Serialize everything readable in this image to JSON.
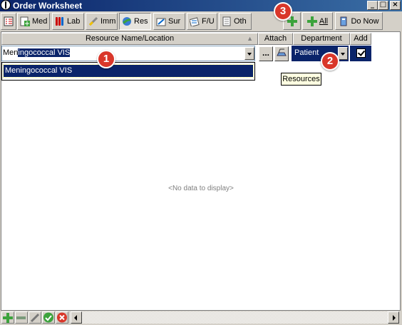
{
  "window": {
    "title": "Order Worksheet"
  },
  "tabs": [
    {
      "label": "",
      "icon": "checklist-icon"
    },
    {
      "label": "Med",
      "icon": "medication-icon"
    },
    {
      "label": "Lab",
      "icon": "test-tubes-icon"
    },
    {
      "label": "Imm",
      "icon": "syringe-icon"
    },
    {
      "label": "Res",
      "icon": "resources-icon",
      "active": true
    },
    {
      "label": "Sur",
      "icon": "surgery-icon"
    },
    {
      "label": "F/U",
      "icon": "follow-up-icon"
    },
    {
      "label": "Oth",
      "icon": "other-icon"
    }
  ],
  "toolbar": {
    "add_all_label": "All",
    "do_now_label": "Do Now"
  },
  "grid": {
    "headers": {
      "resource": "Resource Name/Location",
      "attach": "Attach",
      "department": "Department",
      "add": "Add"
    },
    "row": {
      "resource_typed": "Men",
      "resource_selected": "ingococcal VIS",
      "attach_button": "...",
      "department": "Patient",
      "add_checked": true
    },
    "dropdown_items": [
      "Meningococcal VIS"
    ],
    "empty_text": "<No data to display>"
  },
  "tooltip": "Resources",
  "badges": [
    "1",
    "2",
    "3"
  ],
  "colors": {
    "selection": "#0a246a",
    "badge": "#d9372a",
    "add_green": "#3ca33c"
  }
}
